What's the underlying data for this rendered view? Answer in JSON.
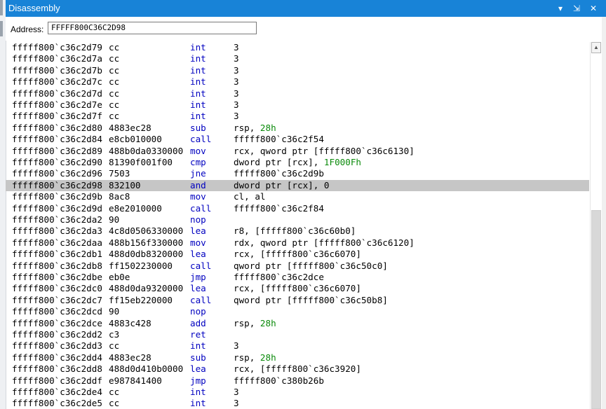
{
  "window": {
    "title": "Disassembly",
    "controls": [
      "▾",
      "⇲",
      "✕"
    ]
  },
  "address_bar": {
    "label": "Address:",
    "value": "FFFFF800C36C2D98"
  },
  "listing": [
    {
      "addr": "fffff800`c36c2d79",
      "bytes": "cc",
      "mnemonic": "int",
      "operand": "3"
    },
    {
      "addr": "fffff800`c36c2d7a",
      "bytes": "cc",
      "mnemonic": "int",
      "operand": "3"
    },
    {
      "addr": "fffff800`c36c2d7b",
      "bytes": "cc",
      "mnemonic": "int",
      "operand": "3"
    },
    {
      "addr": "fffff800`c36c2d7c",
      "bytes": "cc",
      "mnemonic": "int",
      "operand": "3"
    },
    {
      "addr": "fffff800`c36c2d7d",
      "bytes": "cc",
      "mnemonic": "int",
      "operand": "3"
    },
    {
      "addr": "fffff800`c36c2d7e",
      "bytes": "cc",
      "mnemonic": "int",
      "operand": "3"
    },
    {
      "addr": "fffff800`c36c2d7f",
      "bytes": "cc",
      "mnemonic": "int",
      "operand": "3"
    },
    {
      "addr": "fffff800`c36c2d80",
      "bytes": "4883ec28",
      "mnemonic": "sub",
      "operand": "rsp, ",
      "num": "28h"
    },
    {
      "addr": "fffff800`c36c2d84",
      "bytes": "e8cb010000",
      "mnemonic": "call",
      "operand": "fffff800`c36c2f54"
    },
    {
      "addr": "fffff800`c36c2d89",
      "bytes": "488b0da0330000",
      "mnemonic": "mov",
      "operand": "rcx, qword ptr [fffff800`c36c6130]"
    },
    {
      "addr": "fffff800`c36c2d90",
      "bytes": "81390f001f00",
      "mnemonic": "cmp",
      "operand": "dword ptr [rcx], ",
      "num": "1F000Fh"
    },
    {
      "addr": "fffff800`c36c2d96",
      "bytes": "7503",
      "mnemonic": "jne",
      "operand": "fffff800`c36c2d9b"
    },
    {
      "addr": "fffff800`c36c2d98",
      "bytes": "832100",
      "mnemonic": "and",
      "operand": "dword ptr [rcx], 0",
      "current": true
    },
    {
      "addr": "fffff800`c36c2d9b",
      "bytes": "8ac8",
      "mnemonic": "mov",
      "operand": "cl, al"
    },
    {
      "addr": "fffff800`c36c2d9d",
      "bytes": "e8e2010000",
      "mnemonic": "call",
      "operand": "fffff800`c36c2f84"
    },
    {
      "addr": "fffff800`c36c2da2",
      "bytes": "90",
      "mnemonic": "nop",
      "operand": ""
    },
    {
      "addr": "fffff800`c36c2da3",
      "bytes": "4c8d0506330000",
      "mnemonic": "lea",
      "operand": "r8, [fffff800`c36c60b0]"
    },
    {
      "addr": "fffff800`c36c2daa",
      "bytes": "488b156f330000",
      "mnemonic": "mov",
      "operand": "rdx, qword ptr [fffff800`c36c6120]"
    },
    {
      "addr": "fffff800`c36c2db1",
      "bytes": "488d0db8320000",
      "mnemonic": "lea",
      "operand": "rcx, [fffff800`c36c6070]"
    },
    {
      "addr": "fffff800`c36c2db8",
      "bytes": "ff1502230000",
      "mnemonic": "call",
      "operand": "qword ptr [fffff800`c36c50c0]"
    },
    {
      "addr": "fffff800`c36c2dbe",
      "bytes": "eb0e",
      "mnemonic": "jmp",
      "operand": "fffff800`c36c2dce"
    },
    {
      "addr": "fffff800`c36c2dc0",
      "bytes": "488d0da9320000",
      "mnemonic": "lea",
      "operand": "rcx, [fffff800`c36c6070]"
    },
    {
      "addr": "fffff800`c36c2dc7",
      "bytes": "ff15eb220000",
      "mnemonic": "call",
      "operand": "qword ptr [fffff800`c36c50b8]"
    },
    {
      "addr": "fffff800`c36c2dcd",
      "bytes": "90",
      "mnemonic": "nop",
      "operand": ""
    },
    {
      "addr": "fffff800`c36c2dce",
      "bytes": "4883c428",
      "mnemonic": "add",
      "operand": "rsp, ",
      "num": "28h"
    },
    {
      "addr": "fffff800`c36c2dd2",
      "bytes": "c3",
      "mnemonic": "ret",
      "operand": ""
    },
    {
      "addr": "fffff800`c36c2dd3",
      "bytes": "cc",
      "mnemonic": "int",
      "operand": "3"
    },
    {
      "addr": "fffff800`c36c2dd4",
      "bytes": "4883ec28",
      "mnemonic": "sub",
      "operand": "rsp, ",
      "num": "28h"
    },
    {
      "addr": "fffff800`c36c2dd8",
      "bytes": "488d0d410b0000",
      "mnemonic": "lea",
      "operand": "rcx, [fffff800`c36c3920]"
    },
    {
      "addr": "fffff800`c36c2ddf",
      "bytes": "e987841400",
      "mnemonic": "jmp",
      "operand": "fffff800`c380b26b"
    },
    {
      "addr": "fffff800`c36c2de4",
      "bytes": "cc",
      "mnemonic": "int",
      "operand": "3"
    },
    {
      "addr": "fffff800`c36c2de5",
      "bytes": "cc",
      "mnemonic": "int",
      "operand": "3"
    }
  ],
  "colors": {
    "title_bar": "#1883d7",
    "mnemonic": "#0000c0",
    "numeric_literal": "#0a8a0a",
    "current_line": "#c6c6c6"
  }
}
